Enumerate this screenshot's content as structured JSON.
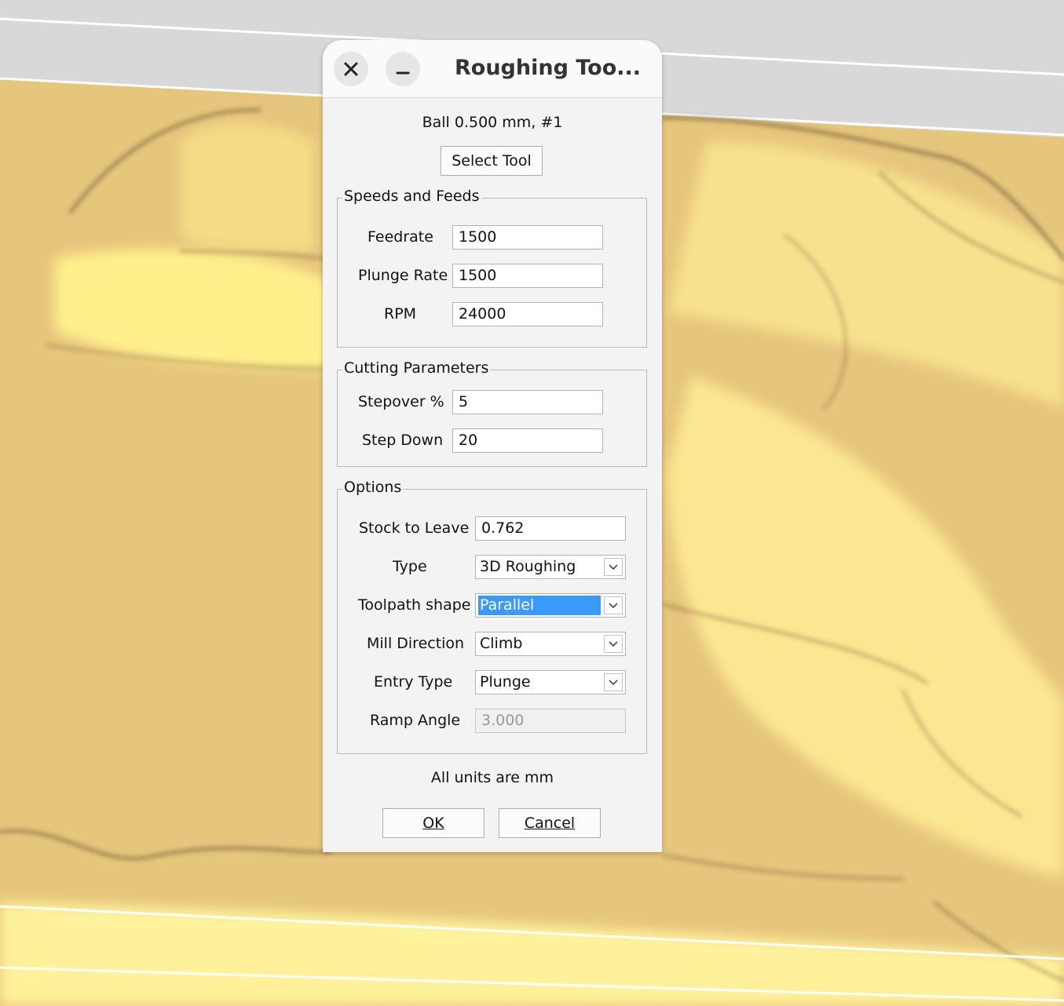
{
  "dialog": {
    "title": "Roughing Too...",
    "tool_name": "Ball 0.500 mm, #1",
    "select_tool_label": "Select Tool",
    "speeds": {
      "title": "Speeds and Feeds",
      "feedrate_label": "Feedrate",
      "feedrate_value": "1500",
      "plunge_label": "Plunge Rate",
      "plunge_value": "1500",
      "rpm_label": "RPM",
      "rpm_value": "24000"
    },
    "cutting": {
      "title": "Cutting Parameters",
      "stepover_label": "Stepover %",
      "stepover_value": "5",
      "stepdown_label": "Step Down",
      "stepdown_value": "20"
    },
    "options": {
      "title": "Options",
      "stock_label": "Stock to Leave",
      "stock_value": "0.762",
      "type_label": "Type",
      "type_value": "3D Roughing",
      "shape_label": "Toolpath shape",
      "shape_value": "Parallel",
      "mill_label": "Mill Direction",
      "mill_value": "Climb",
      "entry_label": "Entry Type",
      "entry_value": "Plunge",
      "ramp_label": "Ramp Angle",
      "ramp_value": "3.000"
    },
    "units_note": "All units are mm",
    "ok_label": "OK",
    "cancel_label": "Cancel"
  },
  "colors": {
    "relief_light": "#fff08c",
    "relief_base": "#e6c57c",
    "selection": "#3b99fc"
  },
  "icons": [
    "close-icon",
    "minimize-icon",
    "chevron-down-icon"
  ]
}
